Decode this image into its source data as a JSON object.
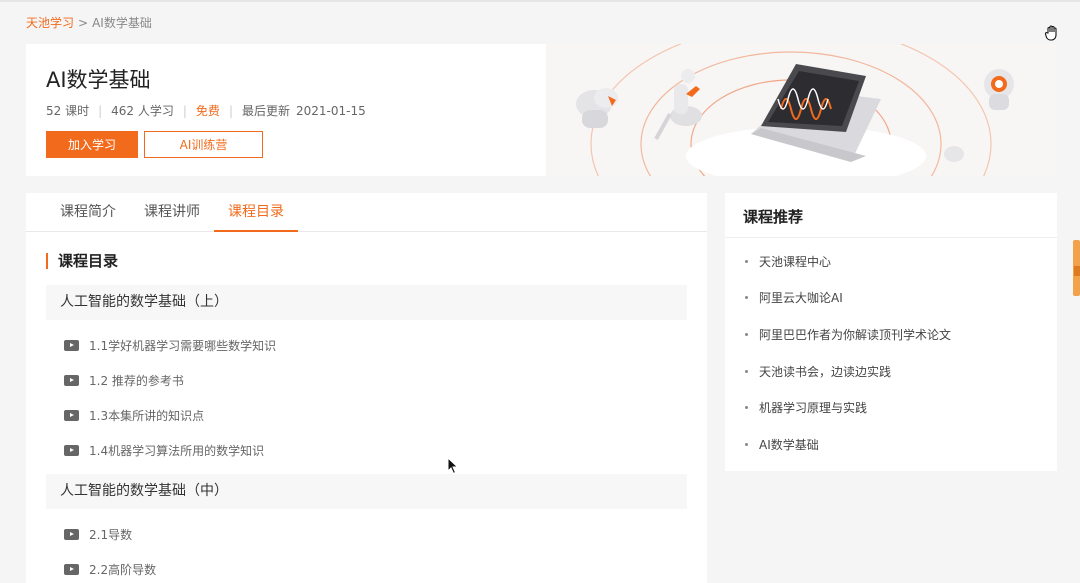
{
  "breadcrumb": {
    "home": "天池学习",
    "separator": ">",
    "current": "AI数学基础"
  },
  "course": {
    "title": "AI数学基础",
    "lessons_count": "52 课时",
    "learners": "462 人学习",
    "price": "免费",
    "updated_label": "最后更新",
    "updated_date": "2021-01-15",
    "join_button": "加入学习",
    "camp_button": "AI训练营"
  },
  "tabs": [
    {
      "label": "课程简介",
      "active": false
    },
    {
      "label": "课程讲师",
      "active": false
    },
    {
      "label": "课程目录",
      "active": true
    }
  ],
  "catalog": {
    "section_title": "课程目录",
    "chapters": [
      {
        "title": "人工智能的数学基础（上）",
        "lessons": [
          "1.1学好机器学习需要哪些数学知识",
          "1.2 推荐的参考书",
          "1.3本集所讲的知识点",
          "1.4机器学习算法所用的数学知识"
        ]
      },
      {
        "title": "人工智能的数学基础（中）",
        "lessons": [
          "2.1导数",
          "2.2高阶导数"
        ]
      }
    ]
  },
  "sidebar": {
    "title": "课程推荐",
    "items": [
      "天池课程中心",
      "阿里云大咖论AI",
      "阿里巴巴作者为你解读顶刊学术论文",
      "天池读书会，边读边实践",
      "机器学习原理与实践",
      "AI数学基础"
    ]
  },
  "colors": {
    "accent": "#f26b1d",
    "background": "#f5f5f6"
  },
  "icons": [
    "hand-cursor-icon",
    "play-icon",
    "mouse-pointer-icon"
  ]
}
